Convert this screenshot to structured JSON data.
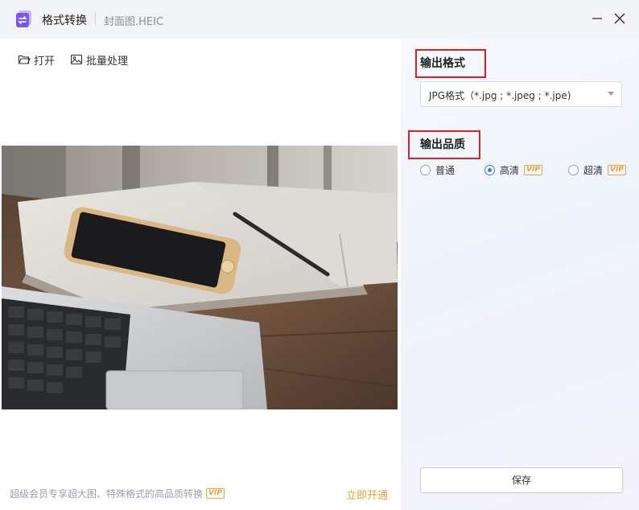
{
  "titlebar": {
    "app_name": "格式转换",
    "file_name": "封面图.HEIC",
    "logo_icon": "convert-app-icon",
    "minimize_icon": "minimize-icon",
    "close_icon": "close-icon"
  },
  "toolbar": {
    "open_label": "打开",
    "open_icon": "folder-open-icon",
    "batch_label": "批量处理",
    "batch_icon": "image-gallery-icon"
  },
  "preview": {
    "image_subject": "photo-of-phone-on-notebook-and-laptop"
  },
  "footer": {
    "promo_text": "超级会员专享超大图、特殊格式的高品质转换",
    "vip_badge": "VIP",
    "activate_label": "立即开通"
  },
  "settings": {
    "format_title": "输出格式",
    "format_selected": "JPG格式（*.jpg ; *.jpeg ; *.jpe)",
    "quality_title": "输出品质",
    "quality_options": [
      {
        "label": "普通",
        "vip": "",
        "checked": false
      },
      {
        "label": "高清",
        "vip": "VIP",
        "checked": true
      },
      {
        "label": "超清",
        "vip": "VIP",
        "checked": false
      }
    ],
    "save_label": "保存"
  },
  "colors": {
    "highlight_box": "#e02020",
    "radio_accent": "#2f7de1",
    "vip_accent": "#e8a33d",
    "activate_link": "#e0a035"
  }
}
